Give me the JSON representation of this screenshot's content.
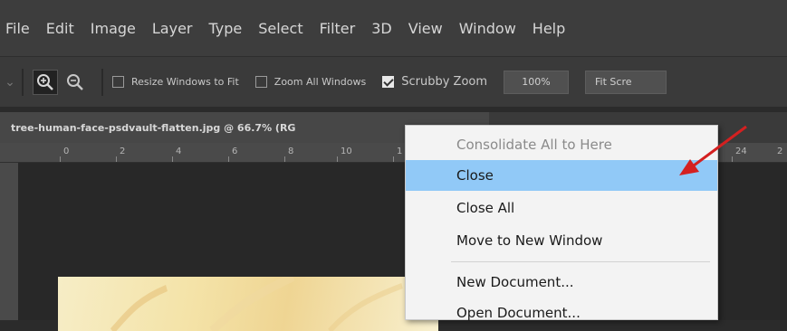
{
  "menubar": {
    "items": [
      "File",
      "Edit",
      "Image",
      "Layer",
      "Type",
      "Select",
      "Filter",
      "3D",
      "View",
      "Window",
      "Help"
    ]
  },
  "options": {
    "zoom_in_icon": "zoom-in-icon",
    "zoom_out_icon": "zoom-out-icon",
    "resize_windows_label": "Resize Windows to Fit",
    "zoom_all_label": "Zoom All Windows",
    "scrubby_zoom_label": "Scrubby Zoom",
    "zoom_value": "100%",
    "fit_screen_label": "Fit Scre"
  },
  "document": {
    "tab_title": "tree-human-face-psdvault-flatten.jpg @ 66.7% (RG"
  },
  "ruler": {
    "ticks": [
      "0",
      "2",
      "4",
      "6",
      "8",
      "10",
      "1",
      "24",
      "2"
    ]
  },
  "context_menu": {
    "items": [
      {
        "label": "Consolidate All to Here",
        "state": "disabled"
      },
      {
        "label": "Close",
        "state": "hover"
      },
      {
        "label": "Close All",
        "state": "normal"
      },
      {
        "label": "Move to New Window",
        "state": "normal"
      },
      {
        "label": "New Document...",
        "state": "normal"
      },
      {
        "label": "Open Document...",
        "state": "normal"
      }
    ]
  },
  "colors": {
    "menu_hover": "#91c9f7",
    "arrow": "#d42020",
    "app_bg": "#2b2b2b"
  }
}
